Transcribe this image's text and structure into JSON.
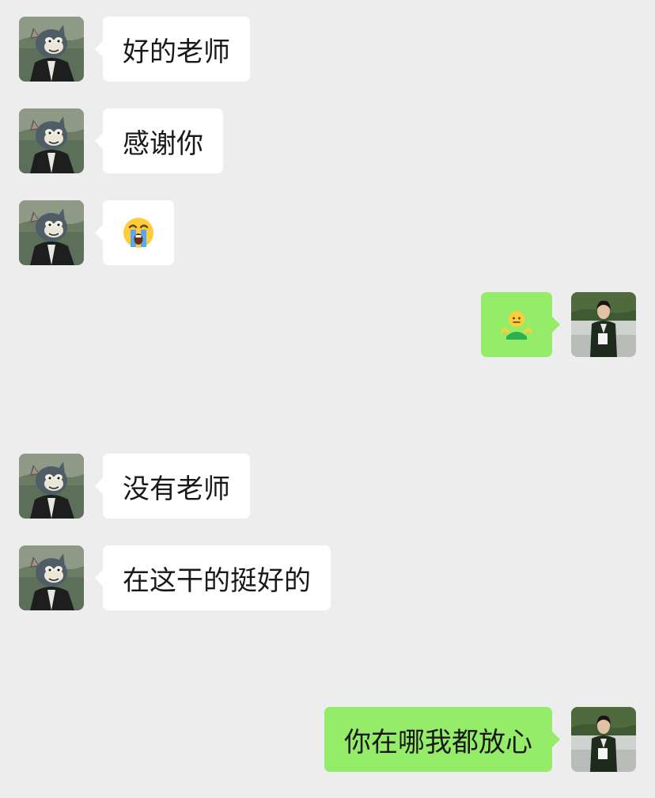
{
  "chat": {
    "messages": [
      {
        "side": "left",
        "type": "text",
        "text": "好的老师"
      },
      {
        "side": "left",
        "type": "text",
        "text": "感谢你"
      },
      {
        "side": "left",
        "type": "emoji",
        "emoji": "loudly-crying-face-emoji"
      },
      {
        "side": "right",
        "type": "emoji",
        "emoji": "person-shrugging-emoji"
      },
      {
        "side": "left",
        "type": "text",
        "text": "没有老师"
      },
      {
        "side": "left",
        "type": "text",
        "text": "在这干的挺好的"
      },
      {
        "side": "right",
        "type": "text",
        "text": "你在哪我都放心"
      }
    ]
  },
  "avatars": {
    "contact": "tom-cat-avatar",
    "self": "uniformed-woman-avatar"
  },
  "colors": {
    "background": "#ededed",
    "incoming_bubble": "#ffffff",
    "outgoing_bubble": "#95ec69",
    "text": "#191919"
  }
}
